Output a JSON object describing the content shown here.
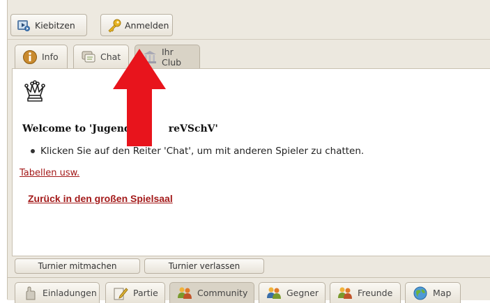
{
  "toolbar": {
    "kiebitzen_label": "Kiebitzen",
    "anmelden_label": "Anmelden"
  },
  "tabs": [
    {
      "label": "Info",
      "icon": "info-icon"
    },
    {
      "label": "Chat",
      "icon": "chat-icon"
    },
    {
      "label": "Ihr Club",
      "icon": "club-icon"
    }
  ],
  "content": {
    "welcome_left": "Welcome to 'Jugend",
    "welcome_right": "reVSchV'",
    "bullet": "Klicken Sie auf den Reiter 'Chat', um mit anderen Spieler zu chatten.",
    "link_tables": "Tabellen usw.",
    "link_back": "Zurück in den großen Spielsaal"
  },
  "tournament": {
    "join_label": "Turnier mitmachen",
    "leave_label": "Turnier verlassen"
  },
  "bottom_tabs": [
    {
      "label": "Einladungen",
      "icon": "hand-icon"
    },
    {
      "label": "Partie",
      "icon": "pencil-icon"
    },
    {
      "label": "Community",
      "icon": "people-icon"
    },
    {
      "label": "Gegner",
      "icon": "people-icon"
    },
    {
      "label": "Freunde",
      "icon": "people-icon"
    },
    {
      "label": "Map",
      "icon": "globe-icon"
    }
  ],
  "colors": {
    "link": "#a31919",
    "arrow": "#e8141c",
    "panel_bg": "#ece8df"
  }
}
